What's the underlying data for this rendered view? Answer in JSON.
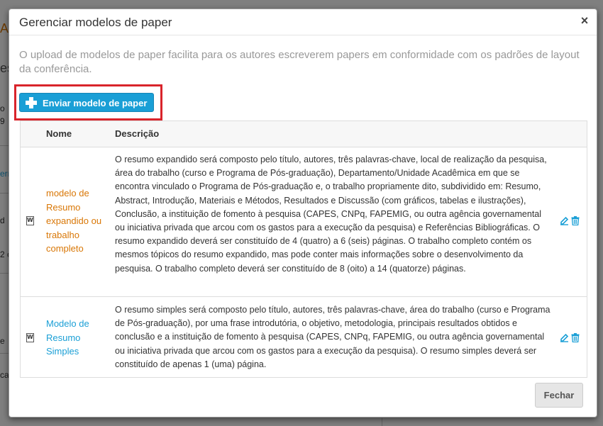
{
  "modal": {
    "title": "Gerenciar modelos de paper",
    "close_symbol": "×",
    "intro": "O upload de modelos de paper facilita para os autores escreverem papers em conformidade com os padrões de layout da conferência.",
    "upload_button": {
      "label": "Enviar modelo de paper",
      "icon": "plus-icon",
      "color": "#1a9fd6"
    },
    "highlight_color": "#d9242b",
    "table": {
      "columns": [
        "Nome",
        "Descrição"
      ],
      "rows": [
        {
          "icon": "word-file-icon",
          "name": "modelo de Resumo expandido ou trabalho completo",
          "name_color": "#d97706",
          "description": "O resumo expandido será composto pelo título, autores, três palavras-chave, local de realização da pesquisa, área do trabalho (curso e Programa de Pós-graduação), Departamento/Unidade Acadêmica em que se encontra vinculado o Programa de Pós-graduação e, o trabalho propriamente dito, subdividido em: Resumo, Abstract, Introdução, Materiais e Métodos, Resultados e Discussão (com gráficos, tabelas e ilustrações), Conclusão, a instituição de fomento à pesquisa (CAPES, CNPq, FAPEMIG, ou outra agência governamental ou iniciativa privada que arcou com os gastos para a execução da pesquisa) e Referências Bibliográficas. O resumo expandido deverá ser constituído de 4 (quatro) a 6 (seis) páginas. O trabalho completo contém os mesmos tópicos do resumo expandido, mas pode conter mais informações sobre o desenvolvimento da pesquisa. O trabalho completo deverá ser constituído de 8 (oito) a 14 (quatorze) páginas.",
          "actions": [
            "edit-icon",
            "trash-icon"
          ]
        },
        {
          "icon": "word-file-icon",
          "name": "Modelo de Resumo Simples",
          "name_color": "#1a9fd6",
          "description": "O resumo simples será composto pelo título, autores, três palavras-chave, área do trabalho (curso e Programa de Pós-graduação), por uma frase introdutória, o objetivo, metodologia, principais resultados obtidos e conclusão e a instituição de fomento à pesquisa (CAPES, CNPq, FAPEMIG, ou outra agência governamental ou iniciativa privada que arcou com os gastos para a execução da pesquisa). O resumo simples deverá ser constituído de apenas 1 (uma) página.",
          "actions": [
            "edit-icon",
            "trash-icon"
          ]
        }
      ]
    },
    "footer": {
      "close_label": "Fechar"
    }
  },
  "background": {
    "fragments": [
      "A",
      "es",
      "o",
      "9",
      "err",
      "d",
      "2 c",
      "e",
      "ca"
    ]
  }
}
